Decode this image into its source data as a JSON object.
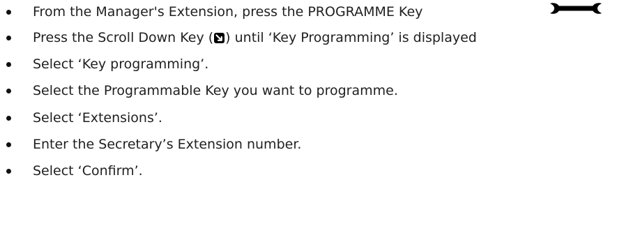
{
  "steps": [
    {
      "text": "From the Manager's Extension, press the PROGRAMME Key"
    },
    {
      "text_before": "Press the Scroll Down Key (",
      "text_after": ") until ‘Key Programming’ is displayed"
    },
    {
      "text": "Select ‘Key programming’."
    },
    {
      "text": "Select the Programmable Key you want to programme."
    },
    {
      "text": "Select ‘Extensions’."
    },
    {
      "text": "Enter the Secretary’s Extension number."
    },
    {
      "text": "Select ‘Confirm’."
    }
  ],
  "icons": {
    "programme_key": "wrench-icon",
    "scroll_down_key": "scroll-down-arrow-icon"
  }
}
